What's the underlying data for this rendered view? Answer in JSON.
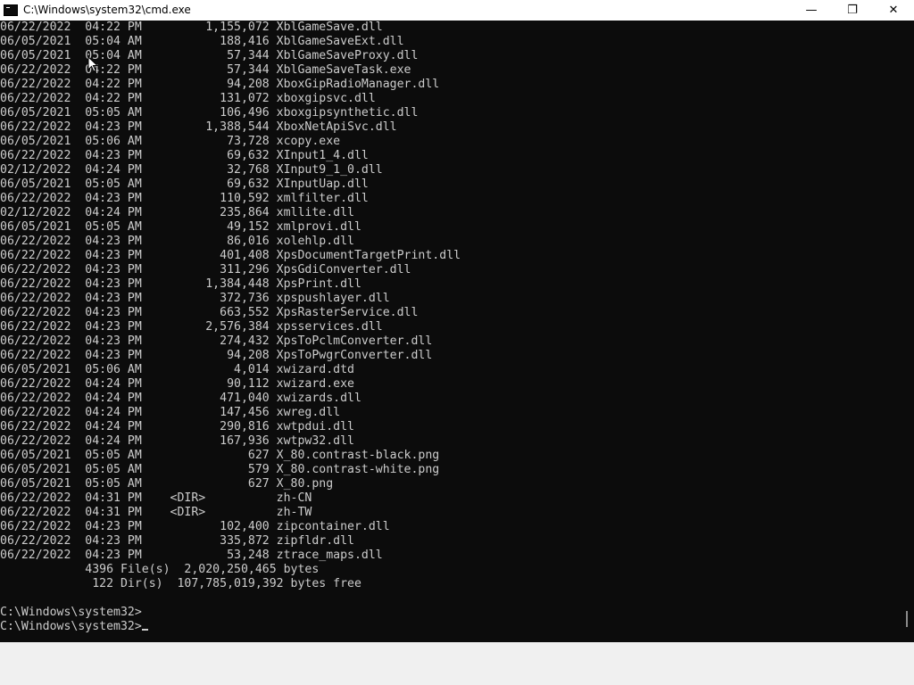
{
  "window": {
    "title": "C:\\Windows\\system32\\cmd.exe",
    "controls": {
      "minimize_icon": "minimize-icon",
      "maximize_icon": "restore-icon",
      "close_icon": "close-icon",
      "minimize_glyph": "—",
      "restore_glyph": "❐",
      "close_glyph": "✕"
    }
  },
  "colors": {
    "console_background": "#0c0c0c",
    "console_text": "#cccccc",
    "titlebar_background": "#ffffff"
  },
  "console": {
    "lines": [
      "06/22/2022  04:22 PM         1,155,072 XblGameSave.dll",
      "06/05/2021  05:04 AM           188,416 XblGameSaveExt.dll",
      "06/05/2021  05:04 AM            57,344 XblGameSaveProxy.dll",
      "06/22/2022  04:22 PM            57,344 XblGameSaveTask.exe",
      "06/22/2022  04:22 PM            94,208 XboxGipRadioManager.dll",
      "06/22/2022  04:22 PM           131,072 xboxgipsvc.dll",
      "06/05/2021  05:05 AM           106,496 xboxgipsynthetic.dll",
      "06/22/2022  04:23 PM         1,388,544 XboxNetApiSvc.dll",
      "06/05/2021  05:06 AM            73,728 xcopy.exe",
      "06/22/2022  04:23 PM            69,632 XInput1_4.dll",
      "02/12/2022  04:24 PM            32,768 XInput9_1_0.dll",
      "06/05/2021  05:05 AM            69,632 XInputUap.dll",
      "06/22/2022  04:23 PM           110,592 xmlfilter.dll",
      "02/12/2022  04:24 PM           235,864 xmllite.dll",
      "06/05/2021  05:05 AM            49,152 xmlprovi.dll",
      "06/22/2022  04:23 PM            86,016 xolehlp.dll",
      "06/22/2022  04:23 PM           401,408 XpsDocumentTargetPrint.dll",
      "06/22/2022  04:23 PM           311,296 XpsGdiConverter.dll",
      "06/22/2022  04:23 PM         1,384,448 XpsPrint.dll",
      "06/22/2022  04:23 PM           372,736 xpspushlayer.dll",
      "06/22/2022  04:23 PM           663,552 XpsRasterService.dll",
      "06/22/2022  04:23 PM         2,576,384 xpsservices.dll",
      "06/22/2022  04:23 PM           274,432 XpsToPclmConverter.dll",
      "06/22/2022  04:23 PM            94,208 XpsToPwgrConverter.dll",
      "06/05/2021  05:06 AM             4,014 xwizard.dtd",
      "06/22/2022  04:24 PM            90,112 xwizard.exe",
      "06/22/2022  04:24 PM           471,040 xwizards.dll",
      "06/22/2022  04:24 PM           147,456 xwreg.dll",
      "06/22/2022  04:24 PM           290,816 xwtpdui.dll",
      "06/22/2022  04:24 PM           167,936 xwtpw32.dll",
      "06/05/2021  05:05 AM               627 X_80.contrast-black.png",
      "06/05/2021  05:05 AM               579 X_80.contrast-white.png",
      "06/05/2021  05:05 AM               627 X_80.png",
      "06/22/2022  04:31 PM    <DIR>          zh-CN",
      "06/22/2022  04:31 PM    <DIR>          zh-TW",
      "06/22/2022  04:23 PM           102,400 zipcontainer.dll",
      "06/22/2022  04:23 PM           335,872 zipfldr.dll",
      "06/22/2022  04:23 PM            53,248 ztrace_maps.dll",
      "            4396 File(s)  2,020,250,465 bytes",
      "             122 Dir(s)  107,785,019,392 bytes free",
      "",
      "C:\\Windows\\system32>"
    ],
    "prompt": "C:\\Windows\\system32>"
  }
}
